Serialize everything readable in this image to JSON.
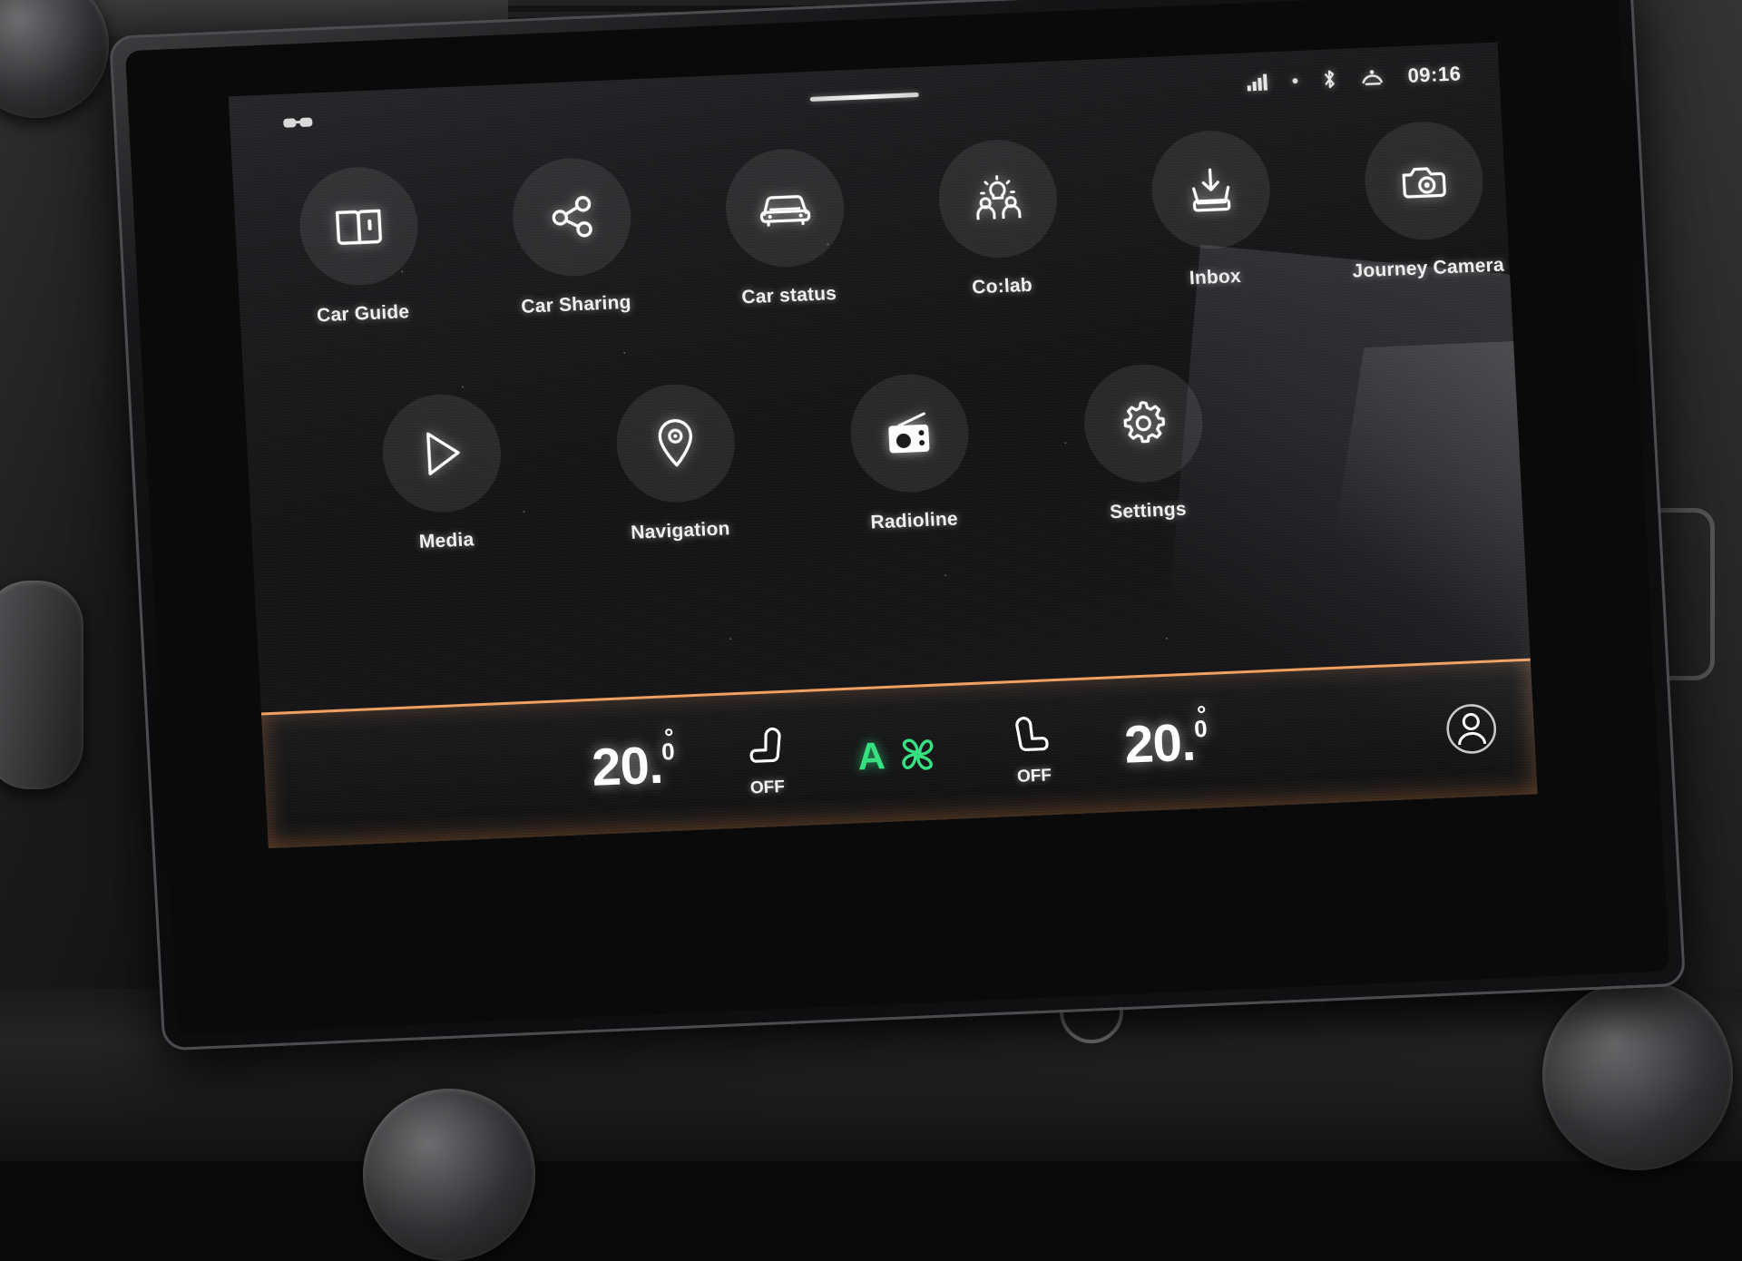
{
  "device": {
    "type": "car-infotainment-touchscreen",
    "context": "vehicle dashboard centre console photograph"
  },
  "status_bar": {
    "left_indicator_icon": "glasses-indicator-icon",
    "drag_handle": "panel-drag-handle",
    "icons": [
      {
        "name": "cellular-signal-icon",
        "label": "Cellular signal"
      },
      {
        "name": "dot-separator-icon",
        "label": ""
      },
      {
        "name": "bluetooth-icon",
        "label": "Bluetooth"
      },
      {
        "name": "wifi-hotspot-icon",
        "label": "Connectivity"
      }
    ],
    "clock": "09:16"
  },
  "home": {
    "apps_row_1": [
      {
        "label": "Car Guide",
        "icon": "book-icon"
      },
      {
        "label": "Car Sharing",
        "icon": "share-nodes-icon"
      },
      {
        "label": "Car status",
        "icon": "car-front-icon"
      },
      {
        "label": "Co:lab",
        "icon": "people-idea-icon"
      },
      {
        "label": "Inbox",
        "icon": "inbox-tray-icon"
      },
      {
        "label": "Journey Camera",
        "icon": "camera-icon"
      }
    ],
    "apps_row_2": [
      {
        "label": "Media",
        "icon": "play-triangle-icon"
      },
      {
        "label": "Navigation",
        "icon": "map-pin-icon"
      },
      {
        "label": "Radioline",
        "icon": "radio-icon"
      },
      {
        "label": "Settings",
        "icon": "gear-icon"
      }
    ],
    "page_indicator": {
      "total": 2,
      "active": 2
    }
  },
  "climate": {
    "driver_temperature": "20.",
    "driver_temperature_decimal": "0",
    "driver_seat": {
      "icon": "seat-heater-icon",
      "state": "OFF"
    },
    "auto_mode": {
      "letter": "A",
      "icon": "fan-icon",
      "color": "#35e07e"
    },
    "passenger_seat": {
      "icon": "seat-heater-icon",
      "state": "OFF"
    },
    "passenger_temperature": "20.",
    "passenger_temperature_decimal": "0",
    "accent_line_color": "#f0a060"
  },
  "profile": {
    "icon": "user-avatar-icon",
    "label": "User profile"
  }
}
